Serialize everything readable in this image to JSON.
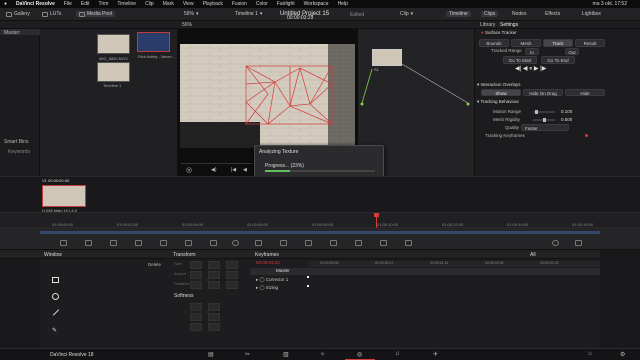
{
  "menubar": {
    "app": "DaVinci Resolve",
    "items": [
      "File",
      "Edit",
      "Trim",
      "Timeline",
      "Clip",
      "Mark",
      "View",
      "Playback",
      "Fusion",
      "Color",
      "Fairlight",
      "Workspace",
      "Help"
    ],
    "clock": "ma 3 okt. 17:52"
  },
  "toolbar": {
    "media_pool": "Media Pool",
    "zoom": "56%",
    "timeline": "Timeline 1",
    "timecode": "00:00:03:23",
    "project": "Untitled Project 15",
    "status": "Edited",
    "clip": "Clip",
    "right_timeline": "Timeline",
    "clips": "Clips",
    "library": "Library",
    "settings": "Settings",
    "nodes": "Nodes",
    "effects": "Effects",
    "lightbox": "Lightbox",
    "gallery": "Gallery",
    "luts": "LUTs"
  },
  "bins": {
    "master": "Master",
    "smart_bins": "Smart Bins",
    "keywords": "Keywords"
  },
  "media": [
    {
      "name": "IMG_6850.MOV"
    },
    {
      "name": "Rick Astley - Never..."
    },
    {
      "name": "Timeline 1"
    }
  ],
  "viewer": {
    "node_label": "S1",
    "transport_time": "00:00:03:23"
  },
  "inspector": {
    "title": "Surface Tracker",
    "tabs": [
      "Bounds",
      "Mesh",
      "Track",
      "Result"
    ],
    "active_tab": "Track",
    "tracked_range_label": "Tracked Range",
    "range_in": "In",
    "range_out": "Out",
    "goto_start": "Go To Start",
    "goto_end": "Go To End",
    "interaction_overlays": "Interaction Overlays",
    "overlay_show": "Show",
    "overlay_hide": "Hide On Drag",
    "overlay_hide2": "Hide",
    "tracking_behaviour": "Tracking Behaviour",
    "motion_range": "Motion Range",
    "motion_range_val": "0.100",
    "mesh_rigidity": "Mesh Rigidity",
    "mesh_rigidity_val": "0.500",
    "quality": "Quality",
    "quality_val": "Faster",
    "tracking_keyframes": "Tracking Keyframes"
  },
  "timeline": {
    "clip_tc": "00:00:00:00",
    "clip_v1": "V1",
    "clip_name": "H.265 Main 10 L4.0",
    "ruler": [
      "01:00:00:00",
      "01:00:02:00",
      "01:00:04:00",
      "01:00:06:00",
      "01:00:08:00",
      "01:00:10:00",
      "01:00:12:00",
      "01:00:14:00",
      "01:00:16:00",
      "01:00:18:00",
      "01:00:20:00"
    ],
    "track_label": "V1"
  },
  "dialog": {
    "title": "Analyzing Texture",
    "progress_text": "Progress... (23%)",
    "progress": 0.23,
    "cancel": "Cancel"
  },
  "window_panel": {
    "title": "Window",
    "delete": "Delete"
  },
  "transform": {
    "title": "Transform",
    "softness": "Softness",
    "x": "X",
    "y": "Y",
    "size": "Size",
    "angle": "Angle",
    "rotation": "Rotation",
    "aspect": "Aspect",
    "invert": "Invert",
    "opacity": "Opacity",
    "inside": "Inside",
    "outside": "Outside"
  },
  "keyframes": {
    "title": "Keyframes",
    "filter": "All",
    "timecode": "00:00:03:23",
    "master": "Master",
    "corrector": "Corrector 1",
    "sizing": "Sizing",
    "ruler": [
      "00:00:00:00",
      "00:00:00:17",
      "00:00:01:11",
      "00:00:02:05",
      "00:00:02:23"
    ]
  },
  "bottom": {
    "app_name": "DaVinci Resolve 18"
  },
  "colors": {
    "accent": "#c64545",
    "progress": "#5fbf5f",
    "node_wire": "#7ed13f"
  }
}
